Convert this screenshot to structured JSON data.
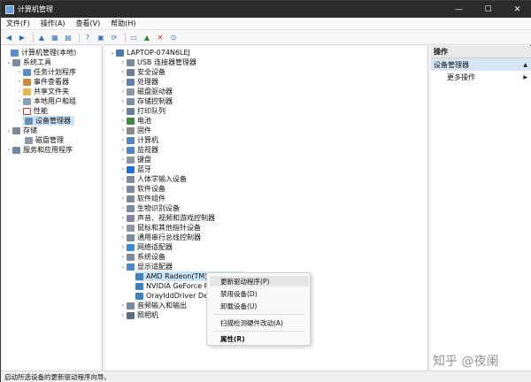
{
  "window": {
    "title": "计算机管理",
    "min": "—",
    "max": "☐",
    "close": "✕"
  },
  "menu": [
    "文件(F)",
    "操作(A)",
    "查看(V)",
    "帮助(H)"
  ],
  "left_tree": [
    {
      "label": "计算机管理(本地)",
      "icon": "computer-icon"
    },
    {
      "label": "系统工具",
      "icon": "tools-icon"
    },
    {
      "label": "任务计划程序",
      "icon": "clock-icon"
    },
    {
      "label": "事件查看器",
      "icon": "log-icon"
    },
    {
      "label": "共享文件夹",
      "icon": "folder-icon"
    },
    {
      "label": "本地用户和组",
      "icon": "users-icon"
    },
    {
      "label": "性能",
      "icon": "performance-icon"
    },
    {
      "label": "设备管理器",
      "icon": "device-manager-icon"
    },
    {
      "label": "存储",
      "icon": "storage-icon"
    },
    {
      "label": "磁盘管理",
      "icon": "disk-icon"
    },
    {
      "label": "服务和应用程序",
      "icon": "services-icon"
    }
  ],
  "device_tree": {
    "root": "LAPTOP-074N6LEJ",
    "categories": [
      "USB 连接器管理器",
      "安全设备",
      "处理器",
      "磁盘驱动器",
      "存储控制器",
      "打印队列",
      "电池",
      "固件",
      "计算机",
      "监视器",
      "键盘",
      "蓝牙",
      "人体学输入设备",
      "软件设备",
      "软件组件",
      "生物识别设备",
      "声音、视频和游戏控制器",
      "鼠标和其他指针设备",
      "通用串行总线控制器",
      "网络适配器",
      "系统设备",
      "显示适配器"
    ],
    "display_adapters": [
      "AMD Radeon(TM) Graphics",
      "NVIDIA GeForce RTX 3050",
      "OrayIddDriver Device"
    ],
    "after": [
      "音频输入和输出",
      "照相机"
    ]
  },
  "context_menu": [
    "更新驱动程序(P)",
    "禁用设备(D)",
    "卸载设备(U)",
    "扫描检测硬件改动(A)",
    "属性(R)"
  ],
  "actions": {
    "header": "操作",
    "selected": "设备管理器",
    "more": "更多操作"
  },
  "status": "启动所选设备的更新驱动程序向导。",
  "watermark": "知乎 @夜阑",
  "colors": {
    "titlebar": "#2b2b2b",
    "selection": "#cce4f7",
    "accent": "#356fb3"
  }
}
